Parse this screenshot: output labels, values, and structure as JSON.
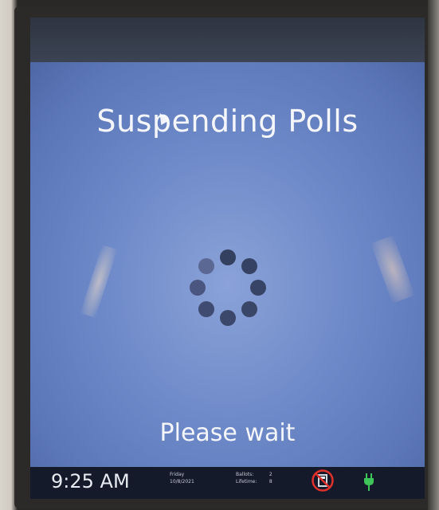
{
  "screen": {
    "title": "Suspending Polls",
    "message": "Please wait"
  },
  "spinner": {
    "icon": "loading-spinner-icon",
    "dot_count": 8
  },
  "statusbar": {
    "time": "9:25 AM",
    "day": "Friday",
    "date": "10/8/2021",
    "ballots_label": "Ballots:",
    "ballots_value": "2",
    "lifetime_label": "Lifetime:",
    "lifetime_value": "8",
    "card_status_icon": "no-card-icon",
    "power_icon": "power-plug-icon"
  },
  "colors": {
    "screen_blue": "#6d89c8",
    "statusbar_bg": "#141a2a",
    "spinner_dot": "#3a4466",
    "no_card_red": "#e0302c",
    "power_green": "#3fc45a"
  }
}
